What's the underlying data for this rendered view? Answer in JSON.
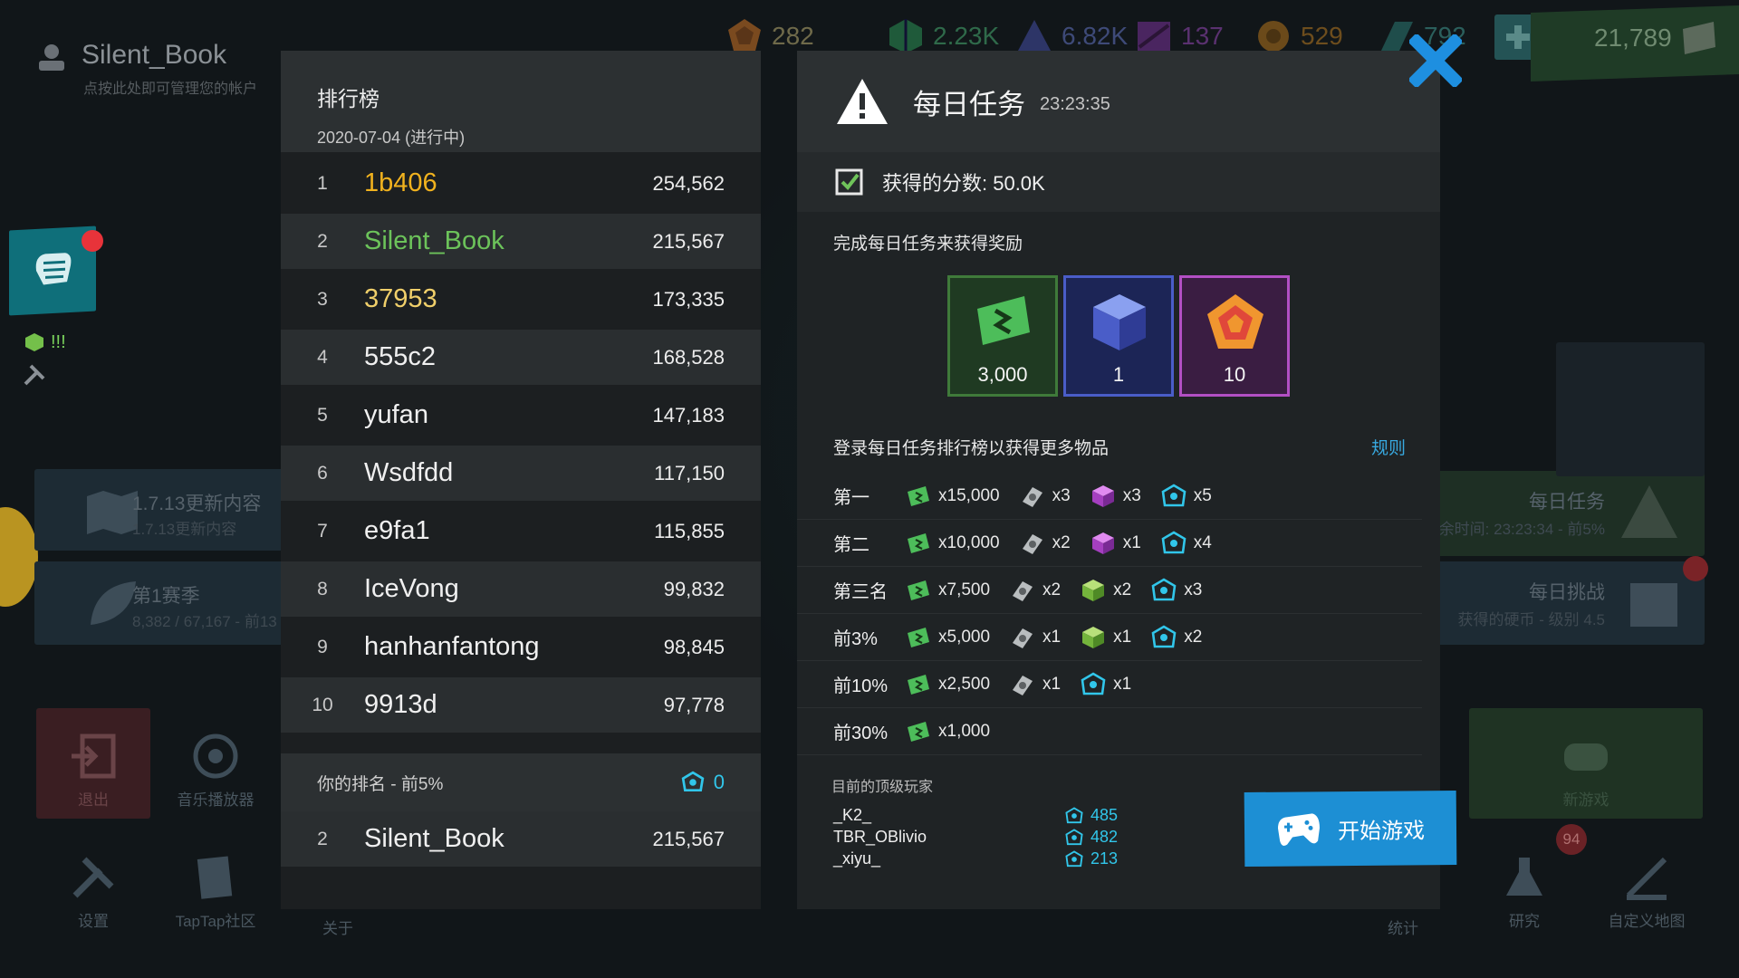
{
  "user": {
    "name": "Silent_Book",
    "hint": "点按此处即可管理您的帐户"
  },
  "resources": [
    {
      "icon": "red-chip-icon",
      "value": "282",
      "color": "#d9772b"
    },
    {
      "icon": "green-cube-icon",
      "value": "2.23K",
      "color": "#3cb25d"
    },
    {
      "icon": "blue-crystal-icon",
      "value": "6.82K",
      "color": "#5a6fd6"
    },
    {
      "icon": "purple-tile-icon",
      "value": "137",
      "color": "#b14fd6"
    },
    {
      "icon": "orange-tile-icon",
      "value": "529",
      "color": "#e0952e"
    },
    {
      "icon": "teal-tile-icon",
      "value": "792",
      "color": "#2fb8b0"
    },
    {
      "icon": "plus-icon",
      "value": "",
      "color": "#3f8f8a"
    },
    {
      "icon": "green-ticket-icon",
      "value": "21,789",
      "color": "#46b257"
    }
  ],
  "left_menu": {
    "alert": "!!!",
    "update_title": "1.7.13更新内容",
    "update_sub": "1.7.13更新内容",
    "season_title": "第1赛季",
    "season_sub": "8,382 / 67,167 - 前13"
  },
  "bottom_buttons": {
    "exit": "退出",
    "music": "音乐播放器",
    "settings": "设置",
    "taptap": "TapTap社区",
    "about": "关于",
    "stats": "统计",
    "research": "研究",
    "research_badge": "94",
    "custom_map": "自定义地图",
    "new_game": "新游戏"
  },
  "right_menu": {
    "daily_quest_title": "每日任务",
    "daily_quest_sub": "余时间: 23:23:34 - 前5%",
    "daily_challenge_title": "每日挑战",
    "daily_challenge_sub": "获得的硬币 - 级别 4.5"
  },
  "leaderboard": {
    "title": "排行榜",
    "date": "2020-07-04 (进行中)",
    "rows": [
      {
        "rank": "1",
        "name": "1b406",
        "score": "254,562",
        "color": "#f1b21e"
      },
      {
        "rank": "2",
        "name": "Silent_Book",
        "score": "215,567",
        "color": "#6cc35a"
      },
      {
        "rank": "3",
        "name": "37953",
        "score": "173,335",
        "color": "#f0cf6a"
      },
      {
        "rank": "4",
        "name": "555c2",
        "score": "168,528",
        "color": "#f0f0f0"
      },
      {
        "rank": "5",
        "name": "yufan",
        "score": "147,183",
        "color": "#f0f0f0"
      },
      {
        "rank": "6",
        "name": "Wsdfdd",
        "score": "117,150",
        "color": "#f0f0f0"
      },
      {
        "rank": "7",
        "name": "e9fa1",
        "score": "115,855",
        "color": "#f0f0f0"
      },
      {
        "rank": "8",
        "name": "IceVong",
        "score": "99,832",
        "color": "#f0f0f0"
      },
      {
        "rank": "9",
        "name": "hanhanfantong",
        "score": "98,845",
        "color": "#f0f0f0"
      },
      {
        "rank": "10",
        "name": "9913d",
        "score": "97,778",
        "color": "#f0f0f0"
      }
    ],
    "your_rank_label": "你的排名 - 前5%",
    "your_tokens": "0",
    "your_row": {
      "rank": "2",
      "name": "Silent_Book",
      "score": "215,567"
    }
  },
  "daily_quest": {
    "title": "每日任务",
    "timer": "23:23:35",
    "score_text": "获得的分数: 50.0K",
    "subtitle": "完成每日任务来获得奖励",
    "rewards": [
      {
        "icon": "green-ticket-icon",
        "qty": "3,000",
        "border": "#3f7a3a",
        "bg": "#1f3a22"
      },
      {
        "icon": "blue-cube-icon",
        "qty": "1",
        "border": "#4a5dc8",
        "bg": "#1c2556"
      },
      {
        "icon": "red-chip-icon",
        "qty": "10",
        "border": "#b24fc4",
        "bg": "#3a1d42"
      }
    ],
    "leaderboard_title": "登录每日任务排行榜以获得更多物品",
    "rules": "规则",
    "tiers": [
      {
        "label": "第一",
        "items": [
          [
            "green-ticket-icon",
            "x15,000"
          ],
          [
            "silver-tile-icon",
            "x3"
          ],
          [
            "purple-cube-icon",
            "x3"
          ],
          [
            "blue-token-icon",
            "x5"
          ]
        ]
      },
      {
        "label": "第二",
        "items": [
          [
            "green-ticket-icon",
            "x10,000"
          ],
          [
            "silver-tile-icon",
            "x2"
          ],
          [
            "purple-cube-icon",
            "x1"
          ],
          [
            "blue-token-icon",
            "x4"
          ]
        ]
      },
      {
        "label": "第三名",
        "items": [
          [
            "green-ticket-icon",
            "x7,500"
          ],
          [
            "silver-tile-icon",
            "x2"
          ],
          [
            "green-cube-icon",
            "x2"
          ],
          [
            "blue-token-icon",
            "x3"
          ]
        ]
      },
      {
        "label": "前3%",
        "items": [
          [
            "green-ticket-icon",
            "x5,000"
          ],
          [
            "silver-tile-icon",
            "x1"
          ],
          [
            "green-cube-icon",
            "x1"
          ],
          [
            "blue-token-icon",
            "x2"
          ]
        ]
      },
      {
        "label": "前10%",
        "items": [
          [
            "green-ticket-icon",
            "x2,500"
          ],
          [
            "silver-tile-icon",
            "x1"
          ],
          [
            "blue-token-icon",
            "x1"
          ]
        ]
      },
      {
        "label": "前30%",
        "items": [
          [
            "green-ticket-icon",
            "x1,000"
          ]
        ]
      }
    ],
    "top_players_title": "目前的顶级玩家",
    "top_players": [
      {
        "name": "_K2_",
        "tokens": "485"
      },
      {
        "name": "TBR_OBlivio",
        "tokens": "482"
      },
      {
        "name": "_xiyu_",
        "tokens": "213"
      }
    ],
    "start_button": "开始游戏"
  }
}
